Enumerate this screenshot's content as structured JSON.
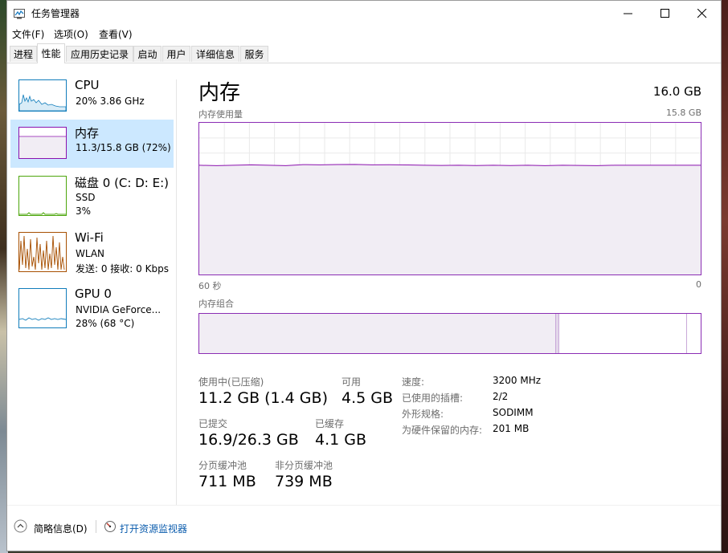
{
  "window": {
    "title": "任务管理器",
    "controls": [
      "minimize",
      "maximize",
      "close"
    ]
  },
  "menu": [
    "文件(F)",
    "选项(O)",
    "查看(V)"
  ],
  "tabs": [
    {
      "label": "进程",
      "active": false
    },
    {
      "label": "性能",
      "active": true
    },
    {
      "label": "应用历史记录",
      "active": false
    },
    {
      "label": "启动",
      "active": false
    },
    {
      "label": "用户",
      "active": false
    },
    {
      "label": "详细信息",
      "active": false
    },
    {
      "label": "服务",
      "active": false
    }
  ],
  "sidebar": [
    {
      "title": "CPU",
      "line1": "20% 3.86 GHz",
      "line2": "",
      "color": "#117dbb",
      "selected": false
    },
    {
      "title": "内存",
      "line1": "11.3/15.8 GB (72%)",
      "line2": "",
      "color": "#8b12ae",
      "selected": true
    },
    {
      "title": "磁盘 0 (C: D: E:)",
      "line1": "SSD",
      "line2": "3%",
      "color": "#4da60c",
      "selected": false
    },
    {
      "title": "Wi-Fi",
      "line1": "WLAN",
      "line2": "发送: 0 接收: 0 Kbps",
      "color": "#a74f01",
      "selected": false
    },
    {
      "title": "GPU 0",
      "line1": "NVIDIA GeForce...",
      "line2": "28% (68 °C)",
      "color": "#117dbb",
      "selected": false
    }
  ],
  "main": {
    "title": "内存",
    "capacity": "16.0 GB",
    "usage_label": "内存使用量",
    "usage_max": "15.8 GB",
    "time_left": "60 秒",
    "time_right": "0",
    "composition_label": "内存组合",
    "usage_level": 0.72,
    "accent": "#8b12ae"
  },
  "stats": {
    "in_use_label": "使用中(已压缩)",
    "in_use": "11.2 GB (1.4 GB)",
    "available_label": "可用",
    "available": "4.5 GB",
    "committed_label": "已提交",
    "committed": "16.9/26.3 GB",
    "cached_label": "已缓存",
    "cached": "4.1 GB",
    "paged_label": "分页缓冲池",
    "paged": "711 MB",
    "nonpaged_label": "非分页缓冲池",
    "nonpaged": "739 MB"
  },
  "specs": [
    {
      "label": "速度:",
      "value": "3200 MHz"
    },
    {
      "label": "已使用的插槽:",
      "value": "2/2"
    },
    {
      "label": "外形规格:",
      "value": "SODIMM"
    },
    {
      "label": "为硬件保留的内存:",
      "value": "201 MB"
    }
  ],
  "footer": {
    "less_details": "简略信息(D)",
    "open_monitor": "打开资源监视器"
  }
}
